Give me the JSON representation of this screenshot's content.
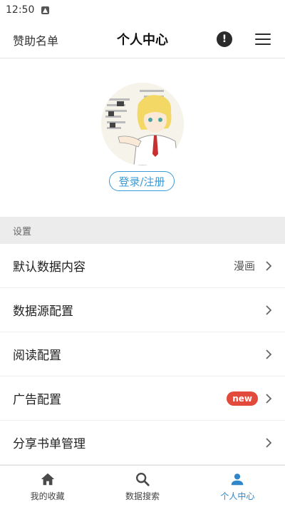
{
  "status_bar": {
    "time": "12:50",
    "notification_icon": "android-icon"
  },
  "header": {
    "sponsor_label": "赞助名单",
    "title": "个人中心",
    "info_icon": "info-icon",
    "menu_icon": "menu-icon"
  },
  "profile": {
    "avatar_icon": "avatar-image",
    "login_label": "登录/注册"
  },
  "settings": {
    "section_title": "设置",
    "items": [
      {
        "label": "默认数据内容",
        "value": "漫画"
      },
      {
        "label": "数据源配置"
      },
      {
        "label": "阅读配置"
      },
      {
        "label": "广告配置",
        "badge": "new"
      },
      {
        "label": "分享书单管理"
      }
    ]
  },
  "bottom_nav": {
    "items": [
      {
        "label": "我的收藏",
        "icon": "home-icon"
      },
      {
        "label": "数据搜索",
        "icon": "search-icon"
      },
      {
        "label": "个人中心",
        "icon": "person-icon",
        "active": true
      }
    ]
  },
  "colors": {
    "accent": "#2f86c8",
    "badge": "#e24a3b",
    "section_bg": "#ececec"
  }
}
